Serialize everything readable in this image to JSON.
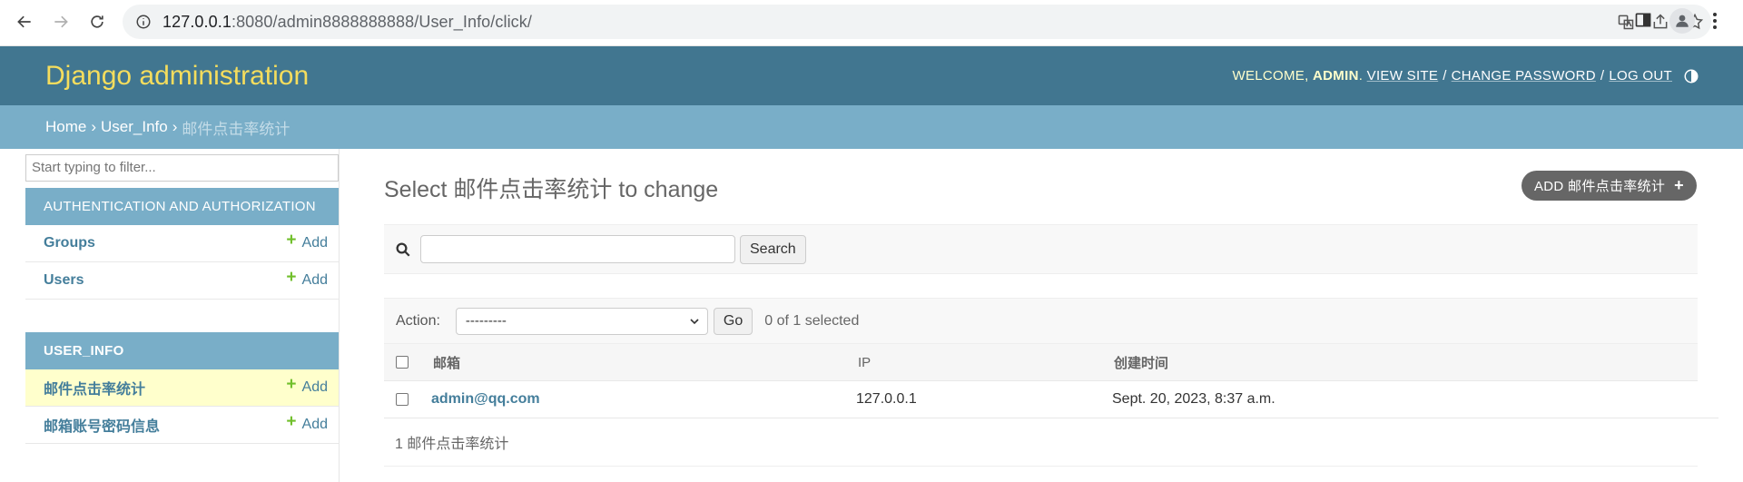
{
  "browser": {
    "url_host": "127.0.0.1",
    "url_rest": ":8080/admin8888888888/User_Info/click/"
  },
  "header": {
    "brand": "Django administration",
    "welcome": "WELCOME,",
    "user": "ADMIN",
    "view_site": "VIEW SITE",
    "change_password": "CHANGE PASSWORD",
    "logout": "LOG OUT"
  },
  "breadcrumbs": {
    "home": "Home",
    "app": "User_Info",
    "current": "邮件点击率统计"
  },
  "sidebar": {
    "filter_placeholder": "Start typing to filter...",
    "auth_caption": "AUTHENTICATION AND AUTHORIZATION",
    "auth_items": [
      {
        "label": "Groups",
        "add": "Add"
      },
      {
        "label": "Users",
        "add": "Add"
      }
    ],
    "userinfo_caption": "USER_INFO",
    "userinfo_items": [
      {
        "label": "邮件点击率统计",
        "add": "Add"
      },
      {
        "label": "邮箱账号密码信息",
        "add": "Add"
      }
    ]
  },
  "content": {
    "title": "Select 邮件点击率统计 to change",
    "add_button": "ADD 邮件点击率统计",
    "search_button": "Search",
    "action_label": "Action:",
    "action_value": "---------",
    "go_button": "Go",
    "selected_count": "0 of 1 selected",
    "columns": [
      "邮箱",
      "IP",
      "创建时间"
    ],
    "rows": [
      {
        "email": "admin@qq.com",
        "ip": "127.0.0.1",
        "created": "Sept. 20, 2023, 8:37 a.m."
      }
    ],
    "paginator": "1 邮件点击率统计"
  }
}
